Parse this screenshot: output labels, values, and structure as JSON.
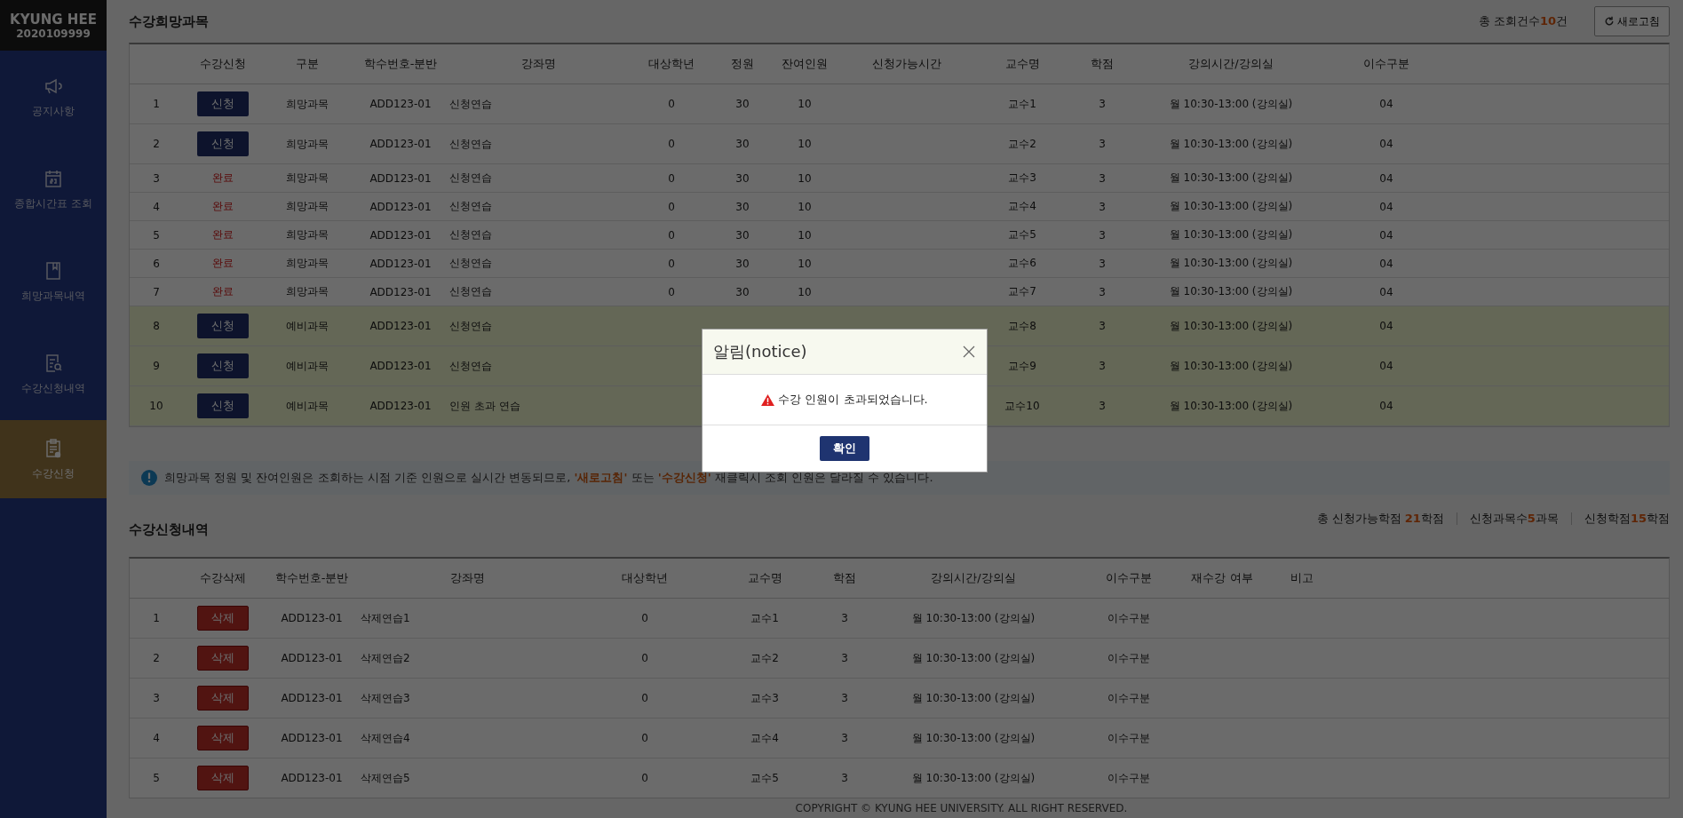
{
  "sidebar": {
    "brand": "KYUNG HEE",
    "student_id": "2020109999",
    "items": [
      {
        "label": "공지사항",
        "selected": false
      },
      {
        "label": "종합시간표 조회",
        "selected": false
      },
      {
        "label": "희망과목내역",
        "selected": false
      },
      {
        "label": "수강신청내역",
        "selected": false
      },
      {
        "label": "수강신청",
        "selected": true
      }
    ]
  },
  "wish_section": {
    "title": "수강희망과목",
    "count": {
      "label": "총 조회건수",
      "value": "10",
      "unit": "건"
    },
    "refresh_button": "새로고침",
    "table": {
      "columns": [
        "수강신청",
        "구분",
        "학수번호-분반",
        "강좌명",
        "대상학년",
        "정원",
        "잔여인원",
        "신청가능시간",
        "교수명",
        "학점",
        "강의시간/강의실",
        "이수구분"
      ],
      "rows": [
        {
          "no": "1",
          "action": {
            "kind": "button",
            "label": "신청"
          },
          "category": "희망과목",
          "code": "ADD123-01",
          "name": "신청연습",
          "grade": "0",
          "capacity": "30",
          "remaining": "10",
          "professor": "교수1",
          "credit": "3",
          "time": "월 10:30-13:00 (강의실)",
          "type": "04",
          "highlighted": false
        },
        {
          "no": "2",
          "action": {
            "kind": "button",
            "label": "신청"
          },
          "category": "희망과목",
          "code": "ADD123-01",
          "name": "신청연습",
          "grade": "0",
          "capacity": "30",
          "remaining": "10",
          "professor": "교수2",
          "credit": "3",
          "time": "월 10:30-13:00 (강의실)",
          "type": "04",
          "highlighted": false
        },
        {
          "no": "3",
          "action": {
            "kind": "status",
            "label": "완료"
          },
          "category": "희망과목",
          "code": "ADD123-01",
          "name": "신청연습",
          "grade": "0",
          "capacity": "30",
          "remaining": "10",
          "professor": "교수3",
          "credit": "3",
          "time": "월 10:30-13:00 (강의실)",
          "type": "04",
          "highlighted": false
        },
        {
          "no": "4",
          "action": {
            "kind": "status",
            "label": "완료"
          },
          "category": "희망과목",
          "code": "ADD123-01",
          "name": "신청연습",
          "grade": "0",
          "capacity": "30",
          "remaining": "10",
          "professor": "교수4",
          "credit": "3",
          "time": "월 10:30-13:00 (강의실)",
          "type": "04",
          "highlighted": false
        },
        {
          "no": "5",
          "action": {
            "kind": "status",
            "label": "완료"
          },
          "category": "희망과목",
          "code": "ADD123-01",
          "name": "신청연습",
          "grade": "0",
          "capacity": "30",
          "remaining": "10",
          "professor": "교수5",
          "credit": "3",
          "time": "월 10:30-13:00 (강의실)",
          "type": "04",
          "highlighted": false
        },
        {
          "no": "6",
          "action": {
            "kind": "status",
            "label": "완료"
          },
          "category": "희망과목",
          "code": "ADD123-01",
          "name": "신청연습",
          "grade": "0",
          "capacity": "30",
          "remaining": "10",
          "professor": "교수6",
          "credit": "3",
          "time": "월 10:30-13:00 (강의실)",
          "type": "04",
          "highlighted": false
        },
        {
          "no": "7",
          "action": {
            "kind": "status",
            "label": "완료"
          },
          "category": "희망과목",
          "code": "ADD123-01",
          "name": "신청연습",
          "grade": "0",
          "capacity": "30",
          "remaining": "10",
          "professor": "교수7",
          "credit": "3",
          "time": "월 10:30-13:00 (강의실)",
          "type": "04",
          "highlighted": false
        },
        {
          "no": "8",
          "action": {
            "kind": "button",
            "label": "신청"
          },
          "category": "예비과목",
          "code": "ADD123-01",
          "name": "신청연습",
          "professor": "교수8",
          "credit": "3",
          "time": "월 10:30-13:00 (강의실)",
          "type": "04",
          "highlighted": true
        },
        {
          "no": "9",
          "action": {
            "kind": "button",
            "label": "신청"
          },
          "category": "예비과목",
          "code": "ADD123-01",
          "name": "신청연습",
          "professor": "교수9",
          "credit": "3",
          "time": "월 10:30-13:00 (강의실)",
          "type": "04",
          "highlighted": true
        },
        {
          "no": "10",
          "action": {
            "kind": "button",
            "label": "신청"
          },
          "category": "예비과목",
          "code": "ADD123-01",
          "name": "인원 초과 연습",
          "professor": "교수10",
          "credit": "3",
          "time": "월 10:30-13:00 (강의실)",
          "type": "04",
          "highlighted": true
        }
      ]
    }
  },
  "notice": [
    {
      "text": "희망과목 정원 및 잔여인원은 조회하는 시점 기준 인원으로 실시간 변동되므로, ",
      "highlight": false
    },
    {
      "text": "'새로고침'",
      "highlight": true
    },
    {
      "text": " 또는 ",
      "highlight": false
    },
    {
      "text": "'수강신청'",
      "highlight": true
    },
    {
      "text": " 재클릭시 조회 인원은 달라질 수 있습니다.",
      "highlight": false
    }
  ],
  "enrolled_section": {
    "title": "수강신청내역",
    "summary": [
      {
        "label": "총 신청가능학점 ",
        "value": "21",
        "unit": "학점"
      },
      {
        "label": "신청과목수",
        "value": "5",
        "unit": "과목"
      },
      {
        "label": "신청학점",
        "value": "15",
        "unit": "학점"
      }
    ],
    "table": {
      "columns": [
        "수강삭제",
        "학수번호-분반",
        "강좌명",
        "대상학년",
        "교수명",
        "학점",
        "강의시간/강의실",
        "이수구분",
        "재수강 여부",
        "비고"
      ],
      "rows": [
        {
          "no": "1",
          "delete": "삭제",
          "code": "ADD123-01",
          "name": "삭제연습1",
          "grade": "0",
          "professor": "교수1",
          "credit": "3",
          "time": "월 10:30-13:00 (강의실)",
          "type": "이수구분"
        },
        {
          "no": "2",
          "delete": "삭제",
          "code": "ADD123-01",
          "name": "삭제연습2",
          "grade": "0",
          "professor": "교수2",
          "credit": "3",
          "time": "월 10:30-13:00 (강의실)",
          "type": "이수구분"
        },
        {
          "no": "3",
          "delete": "삭제",
          "code": "ADD123-01",
          "name": "삭제연습3",
          "grade": "0",
          "professor": "교수3",
          "credit": "3",
          "time": "월 10:30-13:00 (강의실)",
          "type": "이수구분"
        },
        {
          "no": "4",
          "delete": "삭제",
          "code": "ADD123-01",
          "name": "삭제연습4",
          "grade": "0",
          "professor": "교수4",
          "credit": "3",
          "time": "월 10:30-13:00 (강의실)",
          "type": "이수구분"
        },
        {
          "no": "5",
          "delete": "삭제",
          "code": "ADD123-01",
          "name": "삭제연습5",
          "grade": "0",
          "professor": "교수5",
          "credit": "3",
          "time": "월 10:30-13:00 (강의실)",
          "type": "이수구분"
        }
      ]
    }
  },
  "footer": "COPYRIGHT © KYUNG HEE UNIVERSITY. ALL RIGHT RESERVED.",
  "dialog": {
    "title": "알림(notice)",
    "message": "수강 인원이 초과되었습니다.",
    "confirm_button": "확인"
  }
}
